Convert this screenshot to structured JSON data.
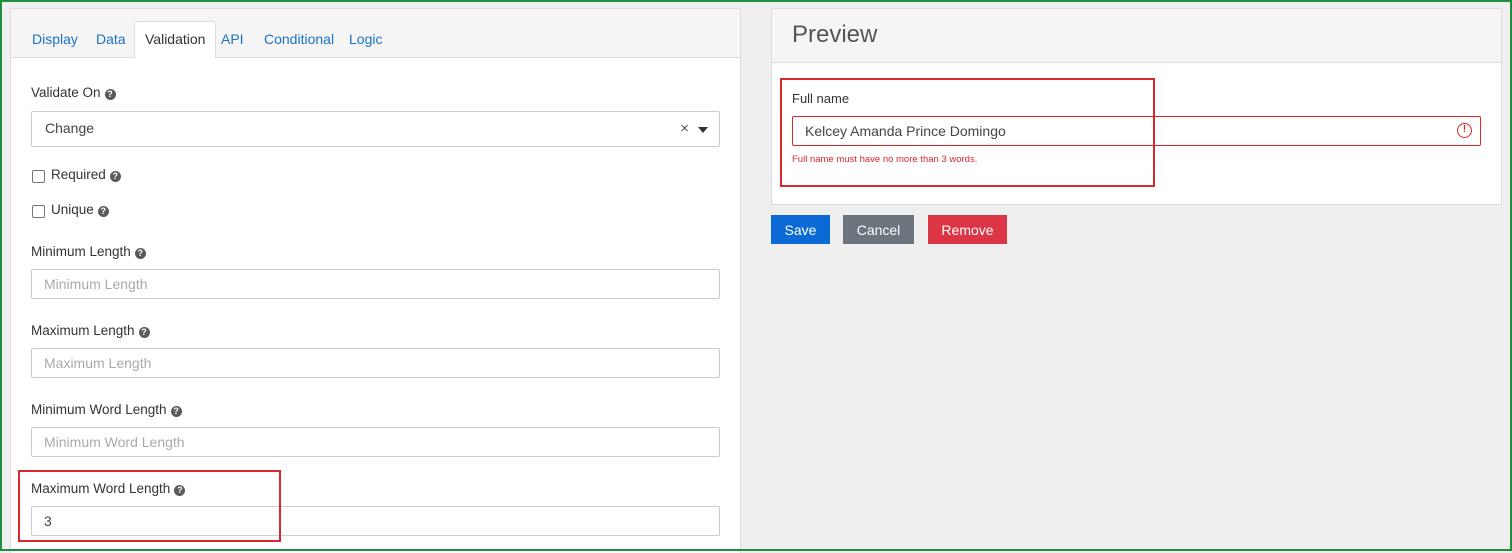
{
  "tabs": [
    {
      "label": "Display"
    },
    {
      "label": "Data"
    },
    {
      "label": "Validation"
    },
    {
      "label": "API"
    },
    {
      "label": "Conditional"
    },
    {
      "label": "Logic"
    }
  ],
  "validation": {
    "validate_on": {
      "label": "Validate On",
      "value": "Change",
      "clear_symbol": "×"
    },
    "required": {
      "label": "Required",
      "checked": false
    },
    "unique": {
      "label": "Unique",
      "checked": false
    },
    "min_length": {
      "label": "Minimum Length",
      "placeholder": "Minimum Length",
      "value": ""
    },
    "max_length": {
      "label": "Maximum Length",
      "placeholder": "Maximum Length",
      "value": ""
    },
    "min_word_length": {
      "label": "Minimum Word Length",
      "placeholder": "Minimum Word Length",
      "value": ""
    },
    "max_word_length": {
      "label": "Maximum Word Length",
      "placeholder": "",
      "value": "3"
    },
    "help_symbol": "?"
  },
  "preview": {
    "title": "Preview",
    "field_label": "Full name",
    "field_value": "Kelcey Amanda Prince Domingo",
    "error_symbol": "!",
    "error_message": "Full name must have no more than 3 words."
  },
  "buttons": {
    "save": "Save",
    "cancel": "Cancel",
    "remove": "Remove"
  },
  "colors": {
    "primary": "#0b6ad6",
    "secondary": "#6c757d",
    "danger": "#dc3545",
    "error": "#d9272e",
    "tab_link": "#1a73c8"
  }
}
